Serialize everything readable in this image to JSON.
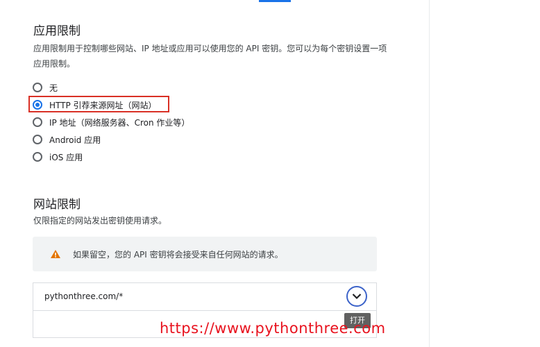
{
  "app_restrictions": {
    "title": "应用限制",
    "desc_line1": "应用限制用于控制哪些网站、IP 地址或应用可以使用您的 API 密钥。您可以为每个密钥设置一项",
    "desc_line2": "应用限制。",
    "options": [
      {
        "label": "无",
        "selected": false
      },
      {
        "label": "HTTP 引荐来源网址（网站）",
        "selected": true
      },
      {
        "label": "IP 地址（网络服务器、Cron 作业等）",
        "selected": false
      },
      {
        "label": "Android 应用",
        "selected": false
      },
      {
        "label": "iOS 应用",
        "selected": false
      }
    ]
  },
  "website_restrictions": {
    "title": "网站限制",
    "desc": "仅限指定的网站发出密钥使用请求。",
    "notice": "如果留空，您的 API 密钥将会接受来自任何网站的请求。",
    "referrers": [
      "pythonthree.com/*"
    ],
    "expand_tooltip": "打开"
  },
  "watermark": "https://www.pythonthree.com",
  "colors": {
    "accent": "#1a73e8",
    "highlight": "#d93025",
    "warning": "#e37400",
    "watermark": "#e8121e"
  },
  "icons": {
    "warning": "warning-icon",
    "expand": "chevron-down-icon"
  }
}
